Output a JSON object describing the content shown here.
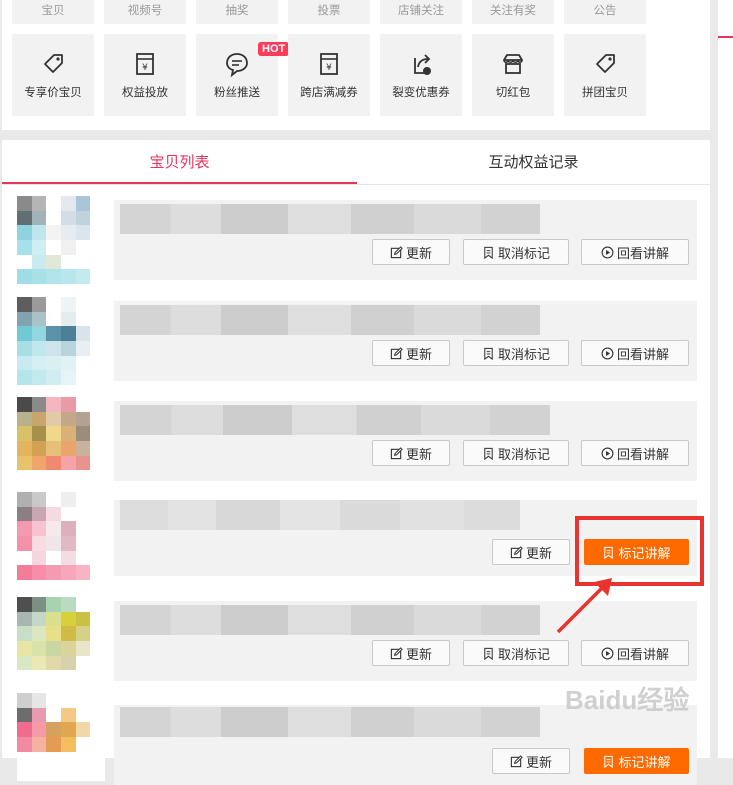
{
  "top_row_labels": [
    "宝贝",
    "视频号",
    "抽奖",
    "投票",
    "店铺关注",
    "关注有奖",
    "公告"
  ],
  "tools": [
    {
      "label": "专享价宝贝",
      "icon": "tag-icon"
    },
    {
      "label": "权益投放",
      "icon": "yen-box-icon"
    },
    {
      "label": "粉丝推送",
      "icon": "chat-bubble-icon",
      "badge": "HOT"
    },
    {
      "label": "跨店满减券",
      "icon": "yen-box-icon"
    },
    {
      "label": "裂变优惠券",
      "icon": "share-coupon-icon"
    },
    {
      "label": "切红包",
      "icon": "store-icon"
    },
    {
      "label": "拼团宝贝",
      "icon": "tag-icon"
    }
  ],
  "tabs": [
    "宝贝列表",
    "互动权益记录"
  ],
  "buttons": {
    "update": "更新",
    "unmark": "取消标记",
    "replay": "回看讲解",
    "mark": "标记讲解"
  },
  "watermark": "Baidu经验",
  "colors": {
    "accent": "#e8335a",
    "orange": "#ff6a00",
    "highlight": "#e8332e"
  }
}
